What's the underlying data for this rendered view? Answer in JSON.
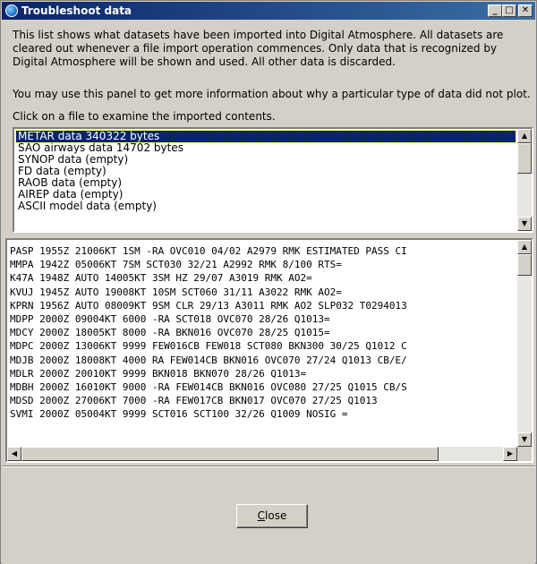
{
  "window": {
    "title": "Troubleshoot data",
    "minimize_label": "_",
    "maximize_label": "□",
    "close_label": "✕"
  },
  "intro_text": "This list shows what datasets have been imported into Digital Atmosphere.  All datasets are cleared out whenever a file import operation commences.  Only data that is recognized by Digital Atmosphere will be shown and used.  All other data is discarded.",
  "help_text": "You may use this panel to get more information about why a particular type of data did not plot.",
  "click_prompt": "Click on a file to examine the imported contents.",
  "file_list": {
    "items": [
      {
        "label": "METAR data  340322 bytes",
        "selected": true
      },
      {
        "label": "SAO airways data  14702 bytes",
        "selected": false
      },
      {
        "label": "SYNOP data  (empty)",
        "selected": false
      },
      {
        "label": "FD data  (empty)",
        "selected": false
      },
      {
        "label": "RAOB data  (empty)",
        "selected": false
      },
      {
        "label": "AIREP data  (empty)",
        "selected": false
      },
      {
        "label": "ASCII model data  (empty)",
        "selected": false
      }
    ]
  },
  "contents": {
    "lines": [
      "PASP 1955Z 21006KT 1SM -RA OVC010 04/02 A2979 RMK ESTIMATED PASS CI",
      "MMPA 1942Z 05006KT 7SM SCT030 32/21 A2992 RMK 8/100 RTS=",
      "K47A 1948Z AUTO 14005KT 3SM HZ 29/07 A3019 RMK AO2=",
      "KVUJ 1945Z AUTO 19008KT 10SM SCT060 31/11 A3022 RMK AO2=",
      "KPRN 1956Z AUTO 08009KT 9SM CLR 29/13 A3011 RMK AO2 SLP032 T0294013",
      "MDPP 2000Z 09004KT 6000 -RA SCT018 OVC070 28/26 Q1013=",
      "MDCY 2000Z 18005KT 8000 -RA BKN016 OVC070 28/25 Q1015=",
      "MDPC 2000Z 13006KT 9999 FEW016CB FEW018 SCT080 BKN300 30/25 Q1012 C",
      "MDJB 2000Z 18008KT 4000 RA FEW014CB BKN016 OVC070 27/24 Q1013 CB/E/",
      "MDLR 2000Z 20010KT 9999 BKN018 BKN070 28/26 Q1013=",
      "MDBH 2000Z 16010KT 9000 -RA FEW014CB BKN016 OVC080 27/25 Q1015 CB/S",
      "MDSD 2000Z 27006KT 7000 -RA FEW017CB BKN017 OVC070 27/25 Q1013",
      "SVMI 2000Z 05004KT 9999 SCT016 SCT100 32/26 Q1009 NOSIG ="
    ]
  },
  "buttons": {
    "close_mnemonic": "C",
    "close_rest": "lose"
  },
  "icons": {
    "title": "app-globe-icon",
    "scroll_up": "▲",
    "scroll_down": "▼",
    "scroll_left": "◀",
    "scroll_right": "▶"
  }
}
